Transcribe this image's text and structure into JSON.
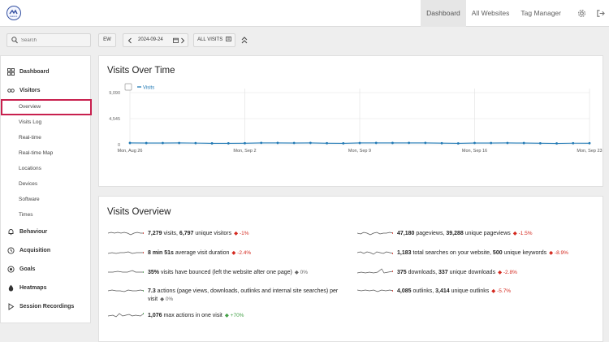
{
  "topbar": {
    "logo_text": "matomo",
    "nav": [
      {
        "label": "Dashboard",
        "active": true
      },
      {
        "label": "All Websites",
        "active": false
      },
      {
        "label": "Tag Manager",
        "active": false
      }
    ],
    "icons": [
      "gear-icon",
      "logout-icon"
    ]
  },
  "toolbar": {
    "search_placeholder": "Search",
    "site_button": "EW",
    "date": "2024-09-24",
    "segment_label": "ALL VISITS",
    "icons": [
      "search-icon",
      "chevron-left-icon",
      "calendar-icon",
      "chevron-right-icon",
      "segment-icon",
      "collapse-icon"
    ]
  },
  "sidebar": {
    "categories": [
      {
        "label": "Dashboard",
        "icon": "dashboard-icon"
      },
      {
        "label": "Visitors",
        "icon": "visitors-icon"
      },
      {
        "label": "Behaviour",
        "icon": "bell-icon"
      },
      {
        "label": "Acquisition",
        "icon": "acquisition-icon"
      },
      {
        "label": "Goals",
        "icon": "goals-icon"
      },
      {
        "label": "Heatmaps",
        "icon": "heatmap-icon"
      },
      {
        "label": "Session Recordings",
        "icon": "play-icon"
      }
    ],
    "visitor_items": [
      "Overview",
      "Visits Log",
      "Real-time",
      "Real-time Map",
      "Locations",
      "Devices",
      "Software",
      "Times"
    ],
    "active_item": "Overview"
  },
  "visits_over_time": {
    "title": "Visits Over Time",
    "legend": "Visits"
  },
  "chart_data": {
    "type": "line",
    "title": "Visits Over Time",
    "series": [
      {
        "name": "Visits",
        "values": [
          290,
          272,
          277,
          289,
          265,
          219,
          225,
          242,
          299,
          296,
          281,
          295,
          245,
          225,
          289,
          296,
          292,
          294,
          295,
          253,
          215,
          281,
          278,
          286,
          272,
          234,
          210,
          250,
          244
        ]
      }
    ],
    "x_ticks": [
      "Mon, Aug 26",
      "Mon, Sep 2",
      "Mon, Sep 9",
      "Mon, Sep 16",
      "Mon, Sep 23"
    ],
    "y_ticks": [
      "0",
      "4,545",
      "9,090"
    ],
    "ylim": [
      0,
      9090
    ],
    "legend_position": "top-left",
    "color": "#1f78b4",
    "grid": true
  },
  "visits_overview": {
    "title": "Visits Overview",
    "metrics": [
      {
        "strong1": "7,279",
        "text1": " visits, ",
        "strong2": "6,797",
        "text2": " unique visitors",
        "trend": "-1%",
        "dir": "down"
      },
      {
        "strong1": "8 min 51s",
        "text1": " average visit duration",
        "strong2": "",
        "text2": "",
        "trend": "-2.4%",
        "dir": "down"
      },
      {
        "strong1": "35%",
        "text1": " visits have bounced (left the website after one page)",
        "strong2": "",
        "text2": "",
        "trend": "0%",
        "dir": "flat"
      },
      {
        "strong1": "7.3",
        "text1": " actions (page views, downloads, outlinks and internal site searches) per visit",
        "strong2": "",
        "text2": "",
        "trend": "0%",
        "dir": "flat"
      },
      {
        "strong1": "1,076",
        "text1": " max actions in one visit",
        "strong2": "",
        "text2": "",
        "trend": "+70%",
        "dir": "up"
      },
      {
        "strong1": "47,180",
        "text1": " pageviews, ",
        "strong2": "39,288",
        "text2": " unique pageviews",
        "trend": "-1.5%",
        "dir": "down"
      },
      {
        "strong1": "1,183",
        "text1": " total searches on your website, ",
        "strong2": "500",
        "text2": " unique keywords",
        "trend": "-8.9%",
        "dir": "down"
      },
      {
        "strong1": "375",
        "text1": " downloads, ",
        "strong2": "337",
        "text2": " unique downloads",
        "trend": "-2.8%",
        "dir": "down"
      },
      {
        "strong1": "4,085",
        "text1": " outlinks, ",
        "strong2": "3,414",
        "text2": " unique outlinks",
        "trend": "-5.7%",
        "dir": "down"
      }
    ]
  }
}
